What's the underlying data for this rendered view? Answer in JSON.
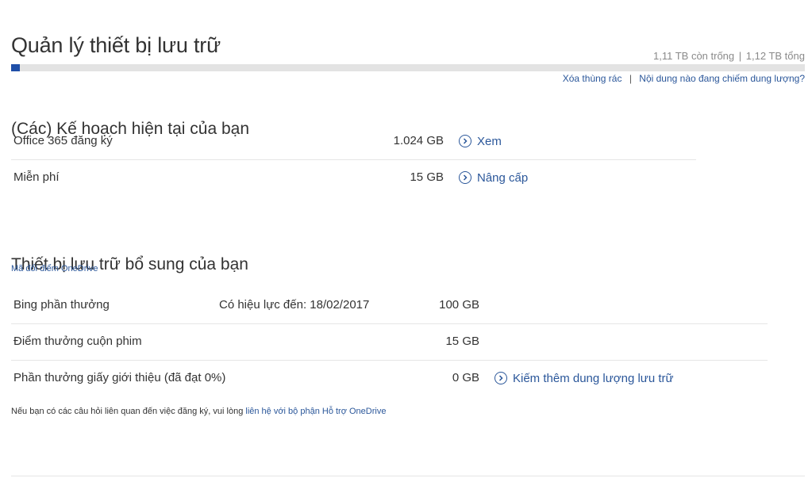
{
  "page": {
    "title": "Quản lý thiết bị lưu trữ"
  },
  "storage": {
    "free": "1,11 TB còn trống",
    "separator": "|",
    "total": "1,12 TB tổng",
    "used_fraction": 0.011,
    "bar_color": "#1f4fa8"
  },
  "links": {
    "empty_recycle_bin": "Xóa thùng rác",
    "divider": "|",
    "whats_taking_space": "Nội dung nào đang chiếm dung lượng?"
  },
  "plans": {
    "heading": "(Các) Kế hoạch hiện tại của bạn",
    "rows": [
      {
        "name": "Office 365 đăng ký",
        "size": "1.024 GB",
        "action": "Xem",
        "action_icon": "chevron-right-circle-icon"
      },
      {
        "name": "Miễn phí",
        "size": "15 GB",
        "action": "Nâng cấp",
        "action_icon": "chevron-right-circle-icon"
      }
    ]
  },
  "extra": {
    "heading": "Thiết bị lưu trữ bổ sung của bạn",
    "redeem_link": "Mã đổi điểm OneDrive",
    "rows": [
      {
        "name": "Bing phần thưởng",
        "valid": "Có hiệu lực đến: 18/02/2017",
        "size": "100 GB"
      },
      {
        "name": "Điểm thưởng cuộn phim",
        "size": "15 GB"
      },
      {
        "name": "Phần thưởng giấy giới thiệu (đã đạt 0%)",
        "size": "0 GB",
        "action": "Kiếm thêm dung lượng lưu trữ",
        "action_icon": "chevron-right-circle-icon"
      }
    ]
  },
  "footer": {
    "text": "Nếu bạn có các câu hỏi liên quan đến việc đăng ký, vui lòng",
    "link": "liên hệ với bộ phận Hỗ trợ OneDrive"
  },
  "colors": {
    "accent": "#2b579a",
    "muted_text": "#8a8a8a",
    "bar_track": "#e3e3e3"
  }
}
